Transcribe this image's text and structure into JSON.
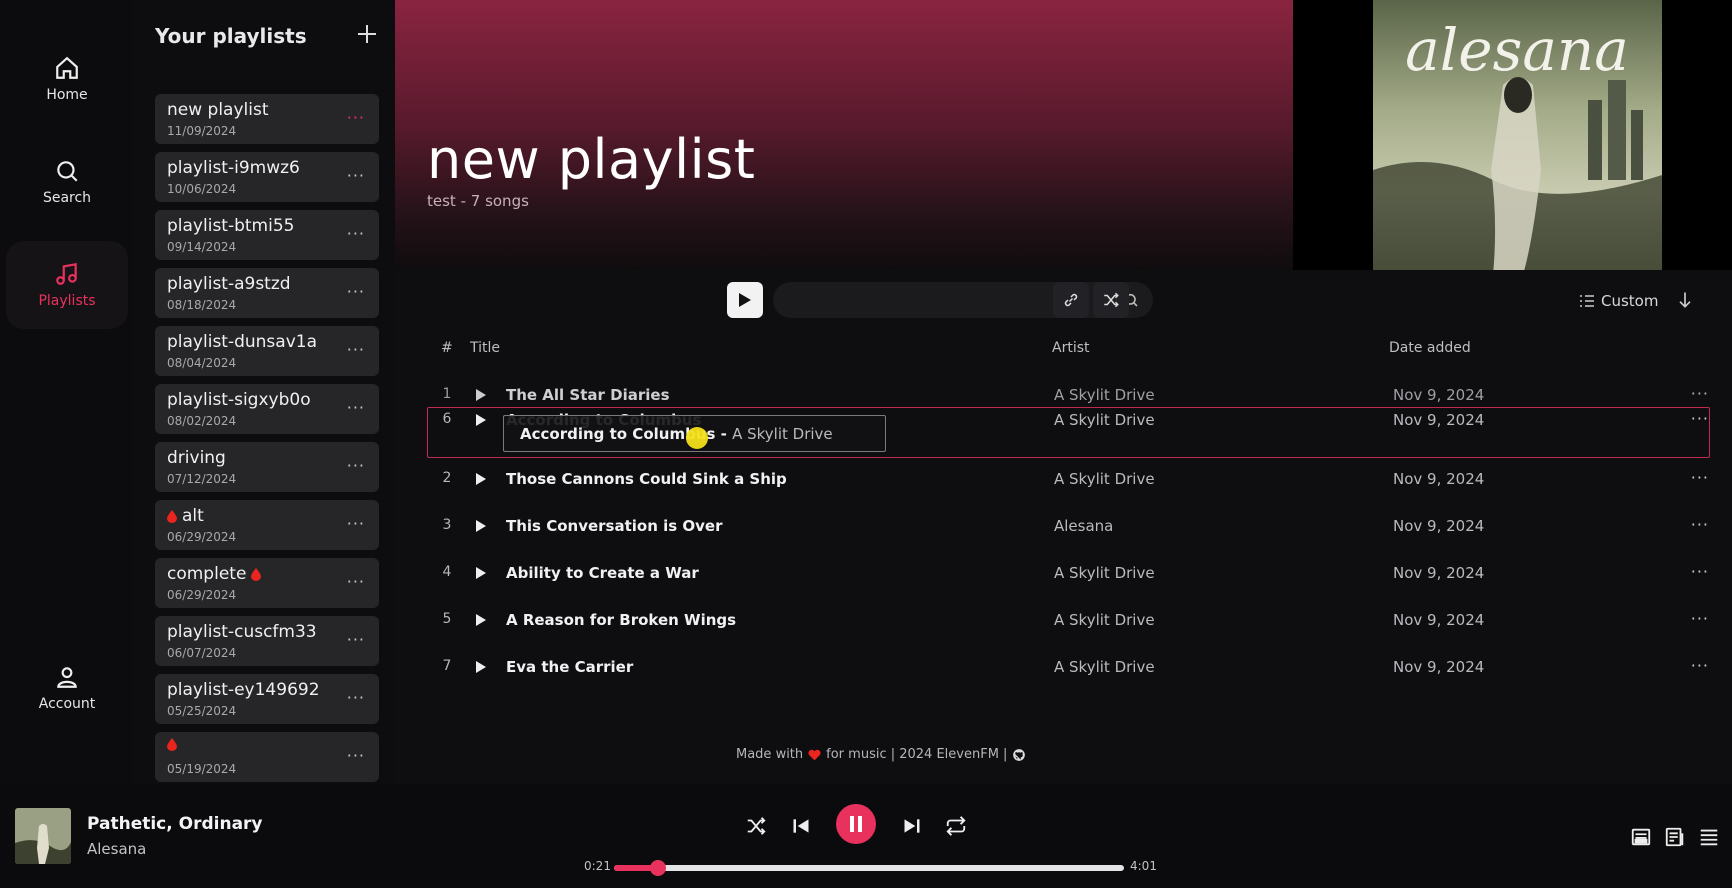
{
  "nav": {
    "home": "Home",
    "search": "Search",
    "playlists": "Playlists",
    "account": "Account",
    "accent": "#e8325d"
  },
  "sidebar": {
    "title": "Your playlists",
    "add_icon": "plus-icon",
    "playlists": [
      {
        "name": "new playlist",
        "date": "11/09/2024"
      },
      {
        "name": "playlist-i9mwz6",
        "date": "10/06/2024"
      },
      {
        "name": "playlist-btmi55",
        "date": "09/14/2024"
      },
      {
        "name": "playlist-a9stzd",
        "date": "08/18/2024"
      },
      {
        "name": "playlist-dunsav1a",
        "date": "08/04/2024"
      },
      {
        "name": "playlist-sigxyb0o",
        "date": "08/02/2024"
      },
      {
        "name": "driving",
        "date": "07/12/2024"
      },
      {
        "name": "alt",
        "date": "06/29/2024"
      },
      {
        "name": "complete",
        "date": "06/29/2024"
      },
      {
        "name": "playlist-cuscfm33",
        "date": "06/07/2024"
      },
      {
        "name": "playlist-ey149692",
        "date": "05/25/2024"
      },
      {
        "name": "",
        "date": "05/19/2024"
      }
    ]
  },
  "header": {
    "title": "new playlist",
    "subtitle": "test - 7 songs",
    "album_text": "alesana"
  },
  "toolbar": {
    "search_placeholder": "",
    "sort_label": "Custom"
  },
  "table": {
    "columns": [
      "#",
      "Title",
      "Artist",
      "Date added"
    ],
    "rows": [
      {
        "num": "1",
        "title": "The All Star Diaries",
        "artist": "A Skylit Drive",
        "date": "Nov 9, 2024"
      },
      {
        "num": "6",
        "title": "According to Columbus",
        "artist": "A Skylit Drive",
        "date": "Nov 9, 2024"
      },
      {
        "num": "2",
        "title": "Those Cannons Could Sink a Ship",
        "artist": "A Skylit Drive",
        "date": "Nov 9, 2024"
      },
      {
        "num": "3",
        "title": "This Conversation is Over",
        "artist": "Alesana",
        "date": "Nov 9, 2024"
      },
      {
        "num": "4",
        "title": "Ability to Create a War",
        "artist": "A Skylit Drive",
        "date": "Nov 9, 2024"
      },
      {
        "num": "5",
        "title": "A Reason for Broken Wings",
        "artist": "A Skylit Drive",
        "date": "Nov 9, 2024"
      },
      {
        "num": "7",
        "title": "Eva the Carrier",
        "artist": "A Skylit Drive",
        "date": "Nov 9, 2024"
      }
    ],
    "drag_label": {
      "title": "According to Columbus",
      "artist": "A Skylit Drive"
    }
  },
  "footer": {
    "made_with": "Made with",
    "for_music": "for music | 2024 ElevenFM |"
  },
  "player": {
    "title": "Pathetic, Ordinary",
    "artist": "Alesana",
    "current_time": "0:21",
    "total_time": "4:01",
    "progress": 0.087
  }
}
